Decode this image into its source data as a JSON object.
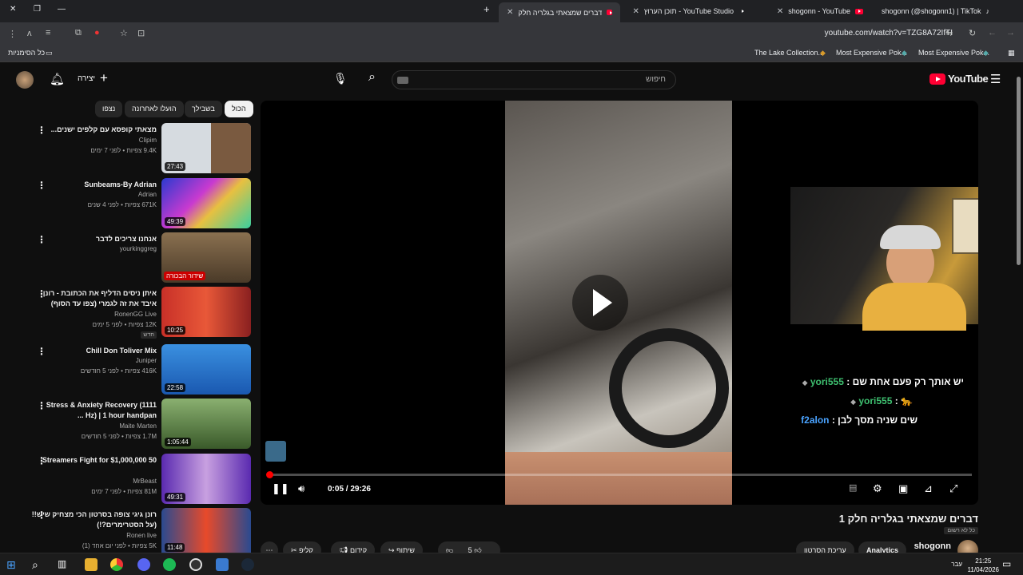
{
  "browser": {
    "tabs": [
      {
        "title": "דברים שמצאתי בגלריה חלק",
        "active": true
      },
      {
        "title": "YouTube Studio - תוכן הערוץ"
      },
      {
        "title": "shogonn - YouTube"
      },
      {
        "title": "shogonn (@shogonn1) | TikTok"
      }
    ],
    "new_tab": "+",
    "url": "youtube.com/watch?v=TZG8A72IfTI",
    "bookmarks": [
      {
        "label": "The Lake Collection..."
      },
      {
        "label": "Most Expensive Pok..."
      },
      {
        "label": "Most Expensive Pok..."
      }
    ],
    "all_bookmarks": "כל הסימניות"
  },
  "youtube": {
    "create_label": "יצירה",
    "search_placeholder": "חיפוש",
    "logo_text": "YouTube",
    "chips": [
      "הכול",
      "בשבילך",
      "הועלו לאחרונה",
      "נצפו"
    ],
    "recommendations": [
      {
        "title": "מצאתי קופסא עם קלפים ישנים...",
        "channel": "Clipim",
        "meta": "9.4K צפיות • לפני 7 ימים",
        "duration": "27:43",
        "thumb": "#d6dbe0"
      },
      {
        "title": "Sunbeams-By Adrian",
        "channel": "Adrian",
        "meta": "671K צפיות • לפני 4 שנים",
        "duration": "49:39",
        "thumb": "#5a3ac8"
      },
      {
        "title": "אנחנו צריכים לדבר",
        "channel": "yourkinggreg",
        "meta": "",
        "duration": "",
        "live": "שידור הבכורה",
        "thumb": "#6a5a40"
      },
      {
        "title": "איתן ניסים הדליף את הכתובת - רונן איבד את זה לגמרי (צפו עד הסוף)",
        "channel": "RonenGG Live",
        "meta": "12K צפיות • לפני 5 ימים",
        "duration": "10:25",
        "badge": "חדש",
        "thumb": "#c83028"
      },
      {
        "title": "Chill Don Toliver Mix",
        "channel": "Juniper",
        "meta": "416K צפיות • לפני 5 חודשים",
        "duration": "22:58",
        "thumb": "#2a78d0"
      },
      {
        "title": "Stress & Anxiety Recovery (1111 Hz) | 1 hour handpan ...",
        "channel": "Maite Marten",
        "meta": "1.7M צפיות • לפני 5 חודשים",
        "duration": "1:05:44",
        "thumb": "#4a6a3a"
      },
      {
        "title": "50 Streamers Fight for $1,000,000",
        "channel": "MrBeast",
        "meta": "81M צפיות • לפני 7 ימים",
        "duration": "49:31",
        "thumb": "#7a3ad0"
      },
      {
        "title": "רונן גיגי צופה בסרטון הכי מצחיק שיש!! (על הסטרימרים?!)",
        "channel": "Ronen live",
        "meta": "5K צפיות • לפני יום אחד (1)",
        "duration": "11:48",
        "thumb": "#2a4a90"
      }
    ],
    "player": {
      "current_time": "0:05",
      "total_time": "29:26",
      "time_display": "0:05 / 29:26",
      "progress": 0.003
    },
    "chat": [
      {
        "user": "yori555",
        "message": "יש אותך רק פעם אחת שם"
      },
      {
        "user": "yori555",
        "message": "🐆"
      },
      {
        "user": "f2alon",
        "message": "שים שניה מסך לבן"
      }
    ],
    "video_title": "דברים שמצאתי בגלריה חלק 1",
    "visibility": "כל לא רשום",
    "channel_name": "shogonn",
    "analytics_label": "Analytics",
    "edit_label": "עריכת הסרטון",
    "likes": "5",
    "share_label": "שיתוף",
    "promote_label": "קידום",
    "clip_label": "קליפ"
  },
  "taskbar": {
    "time": "21:25",
    "date": "11/04/2026",
    "lang": "עבר"
  },
  "colors": {
    "accent": "#ff0033",
    "progress": "#ff0000"
  }
}
